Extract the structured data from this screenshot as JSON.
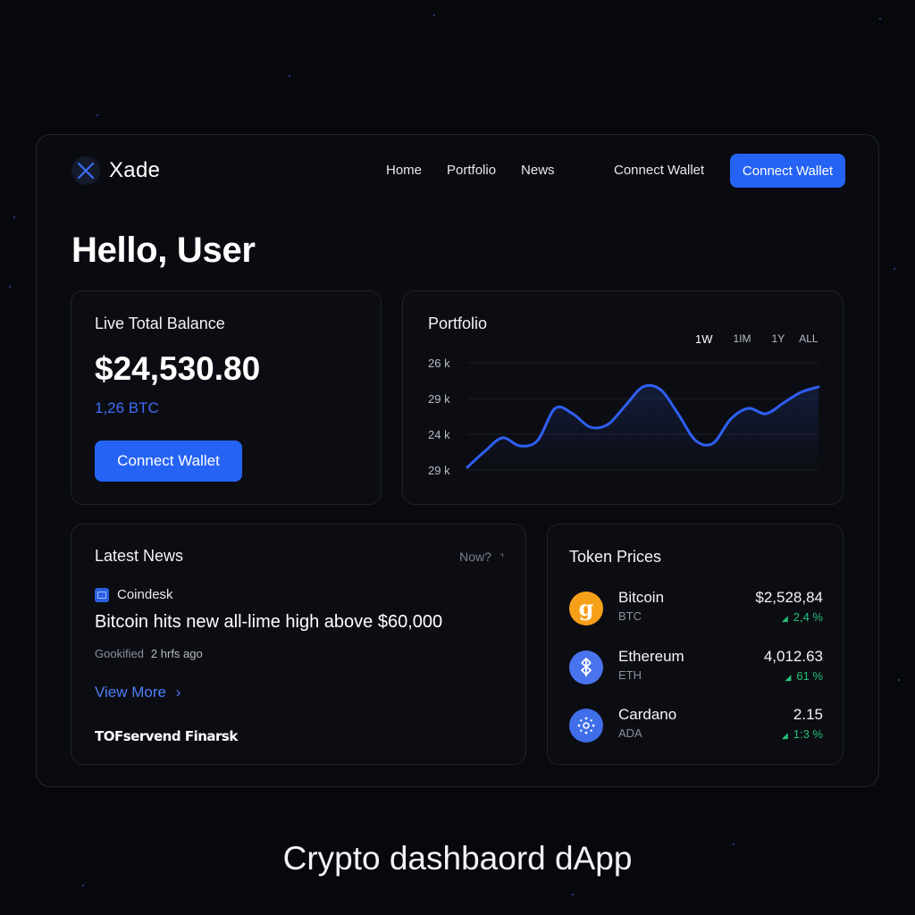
{
  "app": {
    "name": "Xade"
  },
  "nav": {
    "items": [
      "Home",
      "Portfolio",
      "News"
    ],
    "connect_link": "Connect Wallet",
    "connect_button": "Connect Wallet"
  },
  "greeting": "Hello, User",
  "balance": {
    "title": "Live Total Balance",
    "amount": "$24,530.80",
    "btc": "1,26 BTC",
    "button": "Connect Wallet"
  },
  "portfolio": {
    "title": "Portfolio",
    "ranges": [
      "1W",
      "1IM",
      "1Y",
      "ALL"
    ],
    "active_range": "1W"
  },
  "chart_data": {
    "type": "area",
    "title": "Portfolio",
    "y_tick_labels": [
      "26 k",
      "29 k",
      "24 k",
      "29 k"
    ],
    "x": [
      0,
      1,
      2,
      3,
      4,
      5,
      6,
      7,
      8,
      9,
      10,
      11,
      12,
      13,
      14,
      15,
      16,
      17,
      18,
      19,
      20
    ],
    "values": [
      0.05,
      0.35,
      0.6,
      0.45,
      0.55,
      1.15,
      1.05,
      0.8,
      0.85,
      1.2,
      1.55,
      1.5,
      1.05,
      0.55,
      0.5,
      0.95,
      1.15,
      1.05,
      1.25,
      1.45,
      1.55
    ],
    "ylim": [
      0,
      2
    ],
    "color": "#2f5ff2",
    "grid": true
  },
  "news": {
    "title": "Latest News",
    "now": "Now?",
    "source": "Coindesk",
    "headline": "Bitcoin hits new all-lime high above $60,000",
    "author": "Gookified",
    "time": "2 hrfs ago",
    "view_more": "View More",
    "footer": "TOFservend Finarsk"
  },
  "tokens": {
    "title": "Token Prices",
    "items": [
      {
        "name": "Bitcoin",
        "symbol": "BTC",
        "price": "$2,528,84",
        "change": "2,4 %",
        "icon": "bitcoin-icon",
        "color": "#f6a01a"
      },
      {
        "name": "Ethereum",
        "symbol": "ETH",
        "price": "4,012.63",
        "change": "61 %",
        "icon": "ethereum-icon",
        "color": "#4a73ee"
      },
      {
        "name": "Cardano",
        "symbol": "ADA",
        "price": "2.15",
        "change": "1:3 %",
        "icon": "cardano-icon",
        "color": "#3f6ee8"
      }
    ]
  },
  "caption": "Crypto dashbaord dApp"
}
